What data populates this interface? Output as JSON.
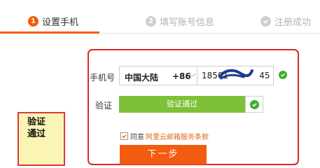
{
  "steps": [
    {
      "number": "1",
      "label": "设置手机",
      "state": "active"
    },
    {
      "number": "2",
      "label": "填写账号信息",
      "state": "inactive"
    },
    {
      "number": "",
      "label": "注册成功",
      "state": "inactive",
      "icon": "check-circle-icon"
    }
  ],
  "colors": {
    "accent": "#f25c05",
    "success_green": "#7cc136",
    "check_green": "#3fae29",
    "annotation_red": "#d42a2a",
    "annotation_fill": "#fbf5b5"
  },
  "form": {
    "phone_label": "手机号",
    "country": "中国大陆",
    "country_code": "+86",
    "country_caret": "﹀",
    "phone_value": "18501",
    "phone_tail": "45",
    "verify_label": "验证",
    "verify_status": "验证通过",
    "agree_prefix": "同意",
    "agree_link": "阿里云邮箱服务条款",
    "next_button": "下一步"
  },
  "annotation": {
    "line1": "验证",
    "line2": "通过"
  }
}
